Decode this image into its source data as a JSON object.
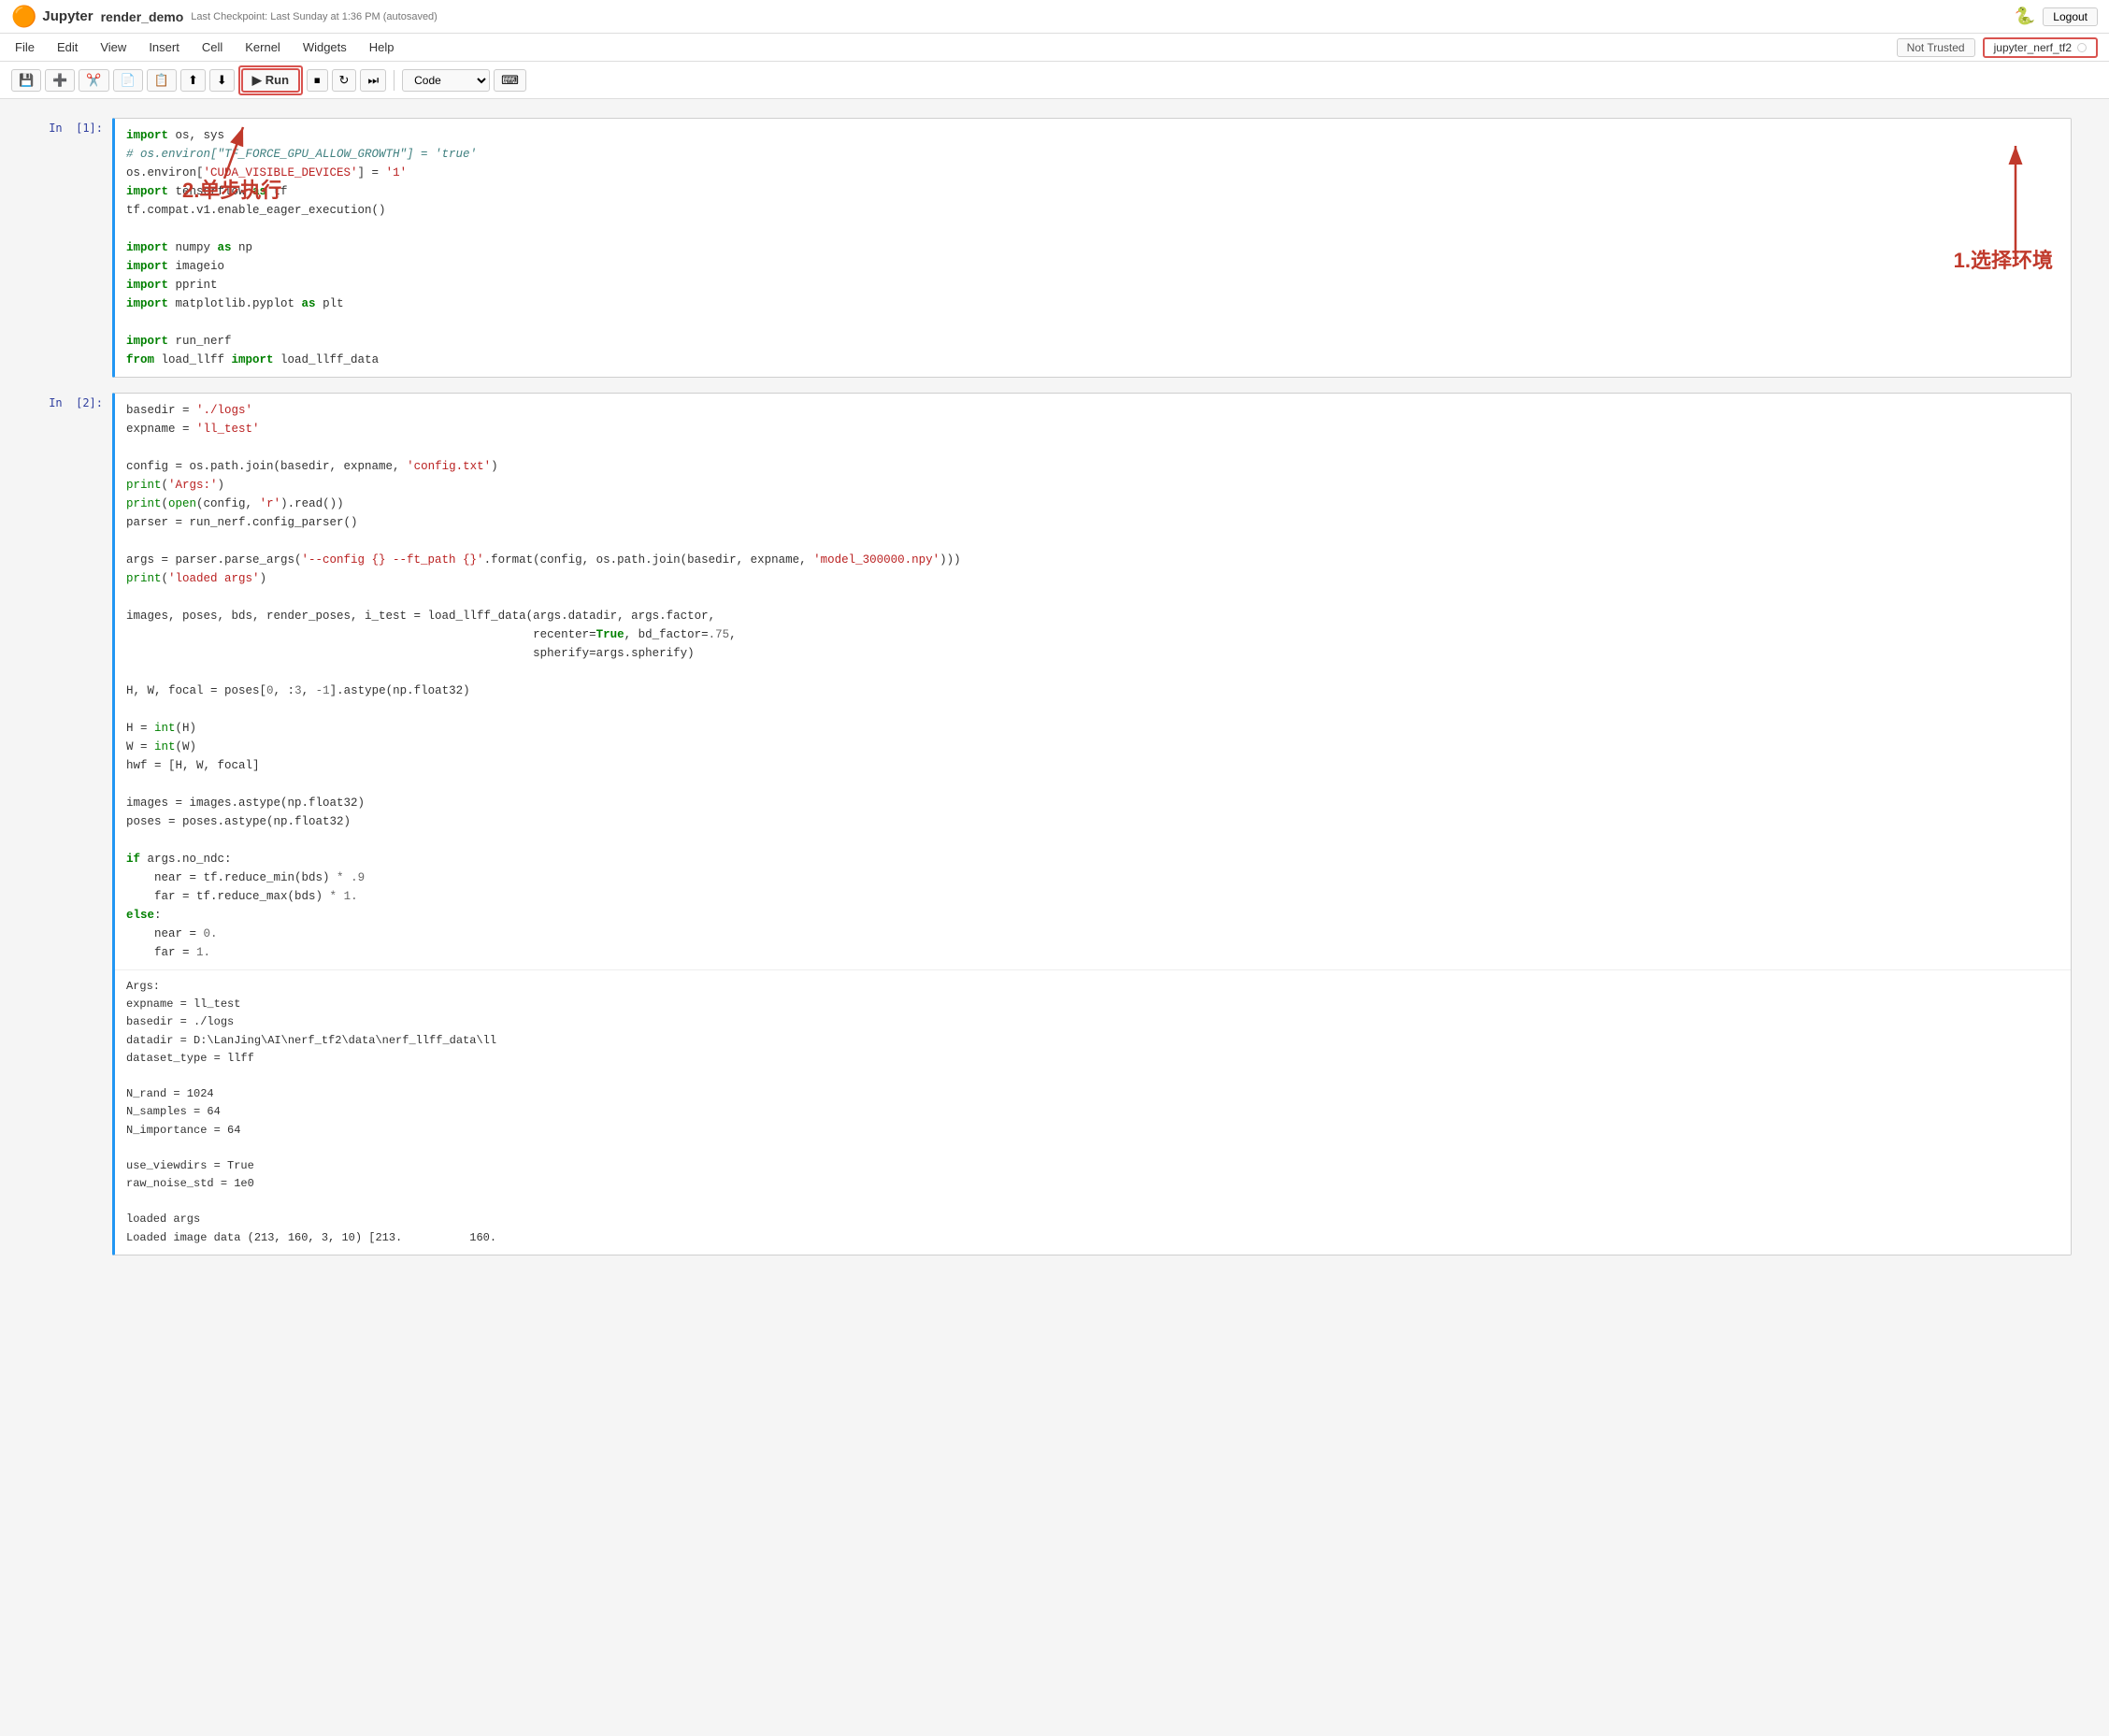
{
  "topbar": {
    "logo": "🟠",
    "app_name": "Jupyter",
    "notebook_title": "render_demo",
    "checkpoint_info": "Last Checkpoint: Last Sunday at 1:36 PM  (autosaved)",
    "python_icon": "🐍",
    "logout_label": "Logout"
  },
  "menubar": {
    "items": [
      "File",
      "Edit",
      "View",
      "Insert",
      "Cell",
      "Kernel",
      "Widgets",
      "Help"
    ],
    "not_trusted_label": "Not Trusted",
    "kernel_name": "jupyter_nerf_tf2"
  },
  "toolbar": {
    "buttons": [
      "💾",
      "➕",
      "✂️",
      "📋",
      "📋",
      "⬆",
      "⬇",
      "▶ Run",
      "⏹",
      "↻",
      "⏭"
    ],
    "run_label": "Run",
    "cell_type": "Code"
  },
  "annotations": {
    "step_exec": "2.单步执行",
    "select_env": "1.选择环境"
  },
  "cells": [
    {
      "prompt": "In  [1]:",
      "code": "import os, sys\n# os.environ[\"TF_FORCE_GPU_ALLOW_GROWTH\"] = 'true'\nos.environ['CUDA_VISIBLE_DEVICES'] = '1'\nimport tensorflow as tf\ntf.compat.v1.enable_eager_execution()\n\nimport numpy as np\nimport imageio\nimport pprint\nimport matplotlib.pyplot as plt\n\nimport run_nerf\nfrom load_llff import load_llff_data",
      "output": ""
    },
    {
      "prompt": "In  [2]:",
      "code": "basedir = './logs'\nexpname = 'll_test'\n\nconfig = os.path.join(basedir, expname, 'config.txt')\nprint('Args:')\nprint(open(config, 'r').read())\nparser = run_nerf.config_parser()\n\nargs = parser.parse_args('--config {} --ft_path {}'.format(config, os.path.join(basedir, expname, 'model_300000.npy')))\nprint('loaded args')\n\nimages, poses, bds, render_poses, i_test = load_llff_data(args.datadir, args.factor,\n                                                          recenter=True, bd_factor=.75,\n                                                          spherify=args.spherify)\n\nH, W, focal = poses[0, :3, -1].astype(np.float32)\n\nH = int(H)\nW = int(W)\nhwf = [H, W, focal]\n\nimages = images.astype(np.float32)\nposes = poses.astype(np.float32)\n\nif args.no_ndc:\n    near = tf.reduce_min(bds) * .9\n    far = tf.reduce_max(bds) * 1.\nelse:\n    near = 0.\n    far = 1.",
      "output": "Args:\nexpname = ll_test\nbasedir = ./logs\ndatadir = D:\\LanJing\\AI\\nerf_tf2\\data\\nerf_llff_data\\ll\ndataset_type = llff\n\nN_rand = 1024\nN_samples = 64\nN_importance = 64\n\nuse_viewdirs = True\nraw_noise_std = 1e0\n\nloaded args\nLoaded image data (213, 160, 3, 10) [213.          160."
    }
  ]
}
